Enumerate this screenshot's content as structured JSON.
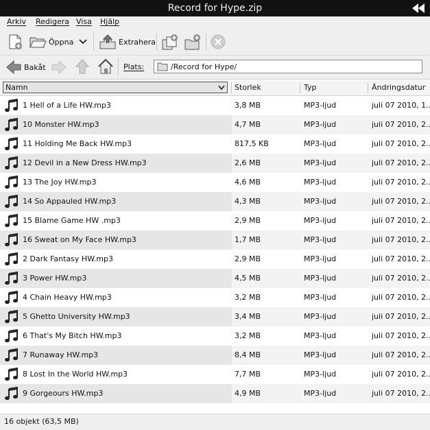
{
  "window": {
    "title": "Record for Hype.zip"
  },
  "menu": [
    {
      "label": "Arkiv"
    },
    {
      "label": "Redigera"
    },
    {
      "label": "Visa"
    },
    {
      "label": "Hjälp"
    }
  ],
  "toolbar": {
    "open_label": "Öppna",
    "extract_label": "Extrahera"
  },
  "navbar": {
    "back_label": "Bakåt",
    "location_label": "Plats:",
    "location_value": "/Record for Hype/"
  },
  "columns": {
    "name": "Namn",
    "size": "Storlek",
    "type": "Typ",
    "modified": "Ändringsdatur"
  },
  "files": [
    {
      "name": "1 Hell of a Life HW.mp3",
      "size": "3,8 MB",
      "type": "MP3-ljud",
      "modified": "juli 07 2010, 1..."
    },
    {
      "name": "10 Monster HW.mp3",
      "size": "4,7 MB",
      "type": "MP3-ljud",
      "modified": "juli 07 2010, 2..."
    },
    {
      "name": "11 Holding Me Back HW.mp3",
      "size": "817,5 KB",
      "type": "MP3-ljud",
      "modified": "juli 07 2010, 2..."
    },
    {
      "name": "12 Devil in a New Dress HW.mp3",
      "size": "2,6 MB",
      "type": "MP3-ljud",
      "modified": "juli 07 2010, 2..."
    },
    {
      "name": "13 The Joy HW.mp3",
      "size": "4,6 MB",
      "type": "MP3-ljud",
      "modified": "juli 07 2010, 2..."
    },
    {
      "name": "14 So Appauled HW.mp3",
      "size": "4,3 MB",
      "type": "MP3-ljud",
      "modified": "juli 07 2010, 2..."
    },
    {
      "name": "15 Blame Game HW .mp3",
      "size": "2,9 MB",
      "type": "MP3-ljud",
      "modified": "juli 07 2010, 2..."
    },
    {
      "name": "16 Sweat on My Face HW.mp3",
      "size": "1,7 MB",
      "type": "MP3-ljud",
      "modified": "juli 07 2010, 2..."
    },
    {
      "name": "2 Dark Fantasy HW.mp3",
      "size": "2,9 MB",
      "type": "MP3-ljud",
      "modified": "juli 07 2010, 2..."
    },
    {
      "name": "3 Power HW.mp3",
      "size": "4,5 MB",
      "type": "MP3-ljud",
      "modified": "juli 07 2010, 2..."
    },
    {
      "name": "4 Chain Heavy HW.mp3",
      "size": "3,2 MB",
      "type": "MP3-ljud",
      "modified": "juli 07 2010, 2..."
    },
    {
      "name": "5 Ghetto University HW.mp3",
      "size": "3,4 MB",
      "type": "MP3-ljud",
      "modified": "juli 07 2010, 2..."
    },
    {
      "name": "6 That's My Bitch HW.mp3",
      "size": "3,2 MB",
      "type": "MP3-ljud",
      "modified": "juli 07 2010, 2..."
    },
    {
      "name": "7 Runaway HW.mp3",
      "size": "8,4 MB",
      "type": "MP3-ljud",
      "modified": "juli 07 2010, 2..."
    },
    {
      "name": "8 Lost In the World HW.mp3",
      "size": "7,7 MB",
      "type": "MP3-ljud",
      "modified": "juli 07 2010, 2..."
    },
    {
      "name": "9 Gorgeours HW.mp3",
      "size": "4,9 MB",
      "type": "MP3-ljud",
      "modified": "juli 07 2010, 2..."
    }
  ],
  "status": {
    "text": "16 objekt (63,5 MB)"
  },
  "icons": {
    "file": "music-note-icon",
    "back": "arrow-left-icon",
    "forward": "arrow-right-icon",
    "up": "arrow-up-icon",
    "home": "home-icon"
  }
}
